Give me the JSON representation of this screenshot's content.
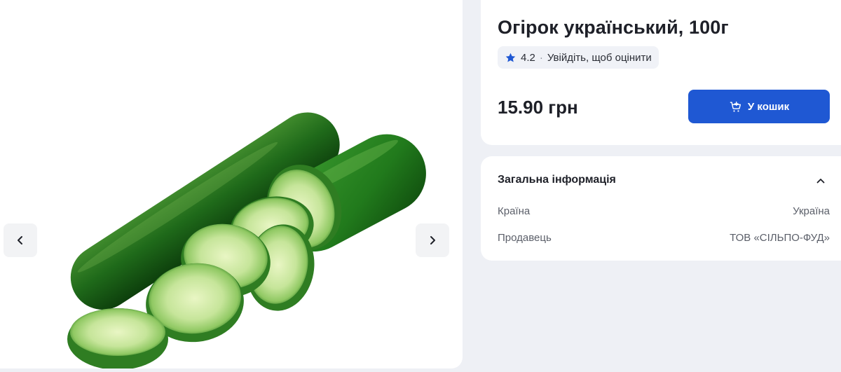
{
  "product": {
    "title": "Огірок український, 100г",
    "image_icon": "cucumber-product-photo"
  },
  "gallery": {
    "prev_icon": "chevron-left-icon",
    "next_icon": "chevron-right-icon"
  },
  "rating": {
    "icon": "star-icon",
    "value": "4.2",
    "separator": "·",
    "login_prompt": "Увійдіть, щоб оцінити"
  },
  "purchase": {
    "price": "15.90 грн",
    "cart_icon": "cart-add-icon",
    "cart_label": "У кошик"
  },
  "info": {
    "title": "Загальна інформація",
    "toggle_icon": "chevron-up-icon",
    "rows": [
      {
        "label": "Країна",
        "value": "Україна"
      },
      {
        "label": "Продавець",
        "value": "ТОВ «СІЛЬПО-ФУД»"
      }
    ]
  },
  "colors": {
    "accent": "#1f58d3",
    "page_bg": "#eef0f5",
    "card_bg": "#ffffff"
  }
}
